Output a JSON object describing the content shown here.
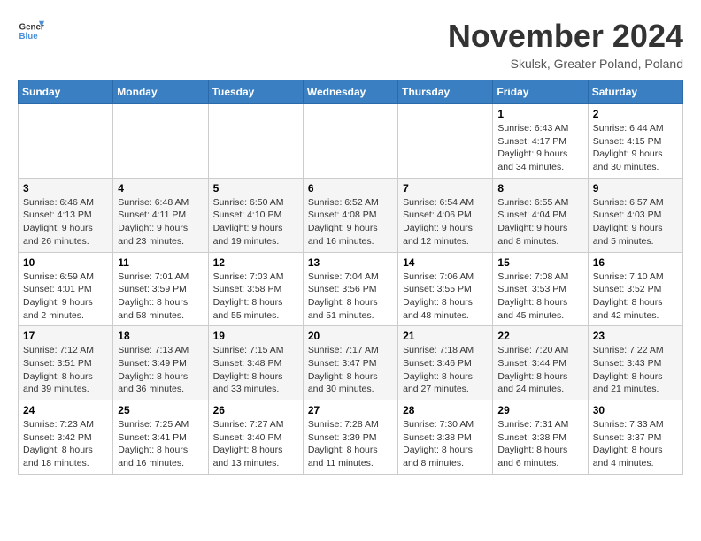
{
  "header": {
    "logo_general": "General",
    "logo_blue": "Blue",
    "month_title": "November 2024",
    "subtitle": "Skulsk, Greater Poland, Poland"
  },
  "days_of_week": [
    "Sunday",
    "Monday",
    "Tuesday",
    "Wednesday",
    "Thursday",
    "Friday",
    "Saturday"
  ],
  "weeks": [
    [
      {
        "day": "",
        "info": ""
      },
      {
        "day": "",
        "info": ""
      },
      {
        "day": "",
        "info": ""
      },
      {
        "day": "",
        "info": ""
      },
      {
        "day": "",
        "info": ""
      },
      {
        "day": "1",
        "info": "Sunrise: 6:43 AM\nSunset: 4:17 PM\nDaylight: 9 hours and 34 minutes."
      },
      {
        "day": "2",
        "info": "Sunrise: 6:44 AM\nSunset: 4:15 PM\nDaylight: 9 hours and 30 minutes."
      }
    ],
    [
      {
        "day": "3",
        "info": "Sunrise: 6:46 AM\nSunset: 4:13 PM\nDaylight: 9 hours and 26 minutes."
      },
      {
        "day": "4",
        "info": "Sunrise: 6:48 AM\nSunset: 4:11 PM\nDaylight: 9 hours and 23 minutes."
      },
      {
        "day": "5",
        "info": "Sunrise: 6:50 AM\nSunset: 4:10 PM\nDaylight: 9 hours and 19 minutes."
      },
      {
        "day": "6",
        "info": "Sunrise: 6:52 AM\nSunset: 4:08 PM\nDaylight: 9 hours and 16 minutes."
      },
      {
        "day": "7",
        "info": "Sunrise: 6:54 AM\nSunset: 4:06 PM\nDaylight: 9 hours and 12 minutes."
      },
      {
        "day": "8",
        "info": "Sunrise: 6:55 AM\nSunset: 4:04 PM\nDaylight: 9 hours and 8 minutes."
      },
      {
        "day": "9",
        "info": "Sunrise: 6:57 AM\nSunset: 4:03 PM\nDaylight: 9 hours and 5 minutes."
      }
    ],
    [
      {
        "day": "10",
        "info": "Sunrise: 6:59 AM\nSunset: 4:01 PM\nDaylight: 9 hours and 2 minutes."
      },
      {
        "day": "11",
        "info": "Sunrise: 7:01 AM\nSunset: 3:59 PM\nDaylight: 8 hours and 58 minutes."
      },
      {
        "day": "12",
        "info": "Sunrise: 7:03 AM\nSunset: 3:58 PM\nDaylight: 8 hours and 55 minutes."
      },
      {
        "day": "13",
        "info": "Sunrise: 7:04 AM\nSunset: 3:56 PM\nDaylight: 8 hours and 51 minutes."
      },
      {
        "day": "14",
        "info": "Sunrise: 7:06 AM\nSunset: 3:55 PM\nDaylight: 8 hours and 48 minutes."
      },
      {
        "day": "15",
        "info": "Sunrise: 7:08 AM\nSunset: 3:53 PM\nDaylight: 8 hours and 45 minutes."
      },
      {
        "day": "16",
        "info": "Sunrise: 7:10 AM\nSunset: 3:52 PM\nDaylight: 8 hours and 42 minutes."
      }
    ],
    [
      {
        "day": "17",
        "info": "Sunrise: 7:12 AM\nSunset: 3:51 PM\nDaylight: 8 hours and 39 minutes."
      },
      {
        "day": "18",
        "info": "Sunrise: 7:13 AM\nSunset: 3:49 PM\nDaylight: 8 hours and 36 minutes."
      },
      {
        "day": "19",
        "info": "Sunrise: 7:15 AM\nSunset: 3:48 PM\nDaylight: 8 hours and 33 minutes."
      },
      {
        "day": "20",
        "info": "Sunrise: 7:17 AM\nSunset: 3:47 PM\nDaylight: 8 hours and 30 minutes."
      },
      {
        "day": "21",
        "info": "Sunrise: 7:18 AM\nSunset: 3:46 PM\nDaylight: 8 hours and 27 minutes."
      },
      {
        "day": "22",
        "info": "Sunrise: 7:20 AM\nSunset: 3:44 PM\nDaylight: 8 hours and 24 minutes."
      },
      {
        "day": "23",
        "info": "Sunrise: 7:22 AM\nSunset: 3:43 PM\nDaylight: 8 hours and 21 minutes."
      }
    ],
    [
      {
        "day": "24",
        "info": "Sunrise: 7:23 AM\nSunset: 3:42 PM\nDaylight: 8 hours and 18 minutes."
      },
      {
        "day": "25",
        "info": "Sunrise: 7:25 AM\nSunset: 3:41 PM\nDaylight: 8 hours and 16 minutes."
      },
      {
        "day": "26",
        "info": "Sunrise: 7:27 AM\nSunset: 3:40 PM\nDaylight: 8 hours and 13 minutes."
      },
      {
        "day": "27",
        "info": "Sunrise: 7:28 AM\nSunset: 3:39 PM\nDaylight: 8 hours and 11 minutes."
      },
      {
        "day": "28",
        "info": "Sunrise: 7:30 AM\nSunset: 3:38 PM\nDaylight: 8 hours and 8 minutes."
      },
      {
        "day": "29",
        "info": "Sunrise: 7:31 AM\nSunset: 3:38 PM\nDaylight: 8 hours and 6 minutes."
      },
      {
        "day": "30",
        "info": "Sunrise: 7:33 AM\nSunset: 3:37 PM\nDaylight: 8 hours and 4 minutes."
      }
    ]
  ]
}
